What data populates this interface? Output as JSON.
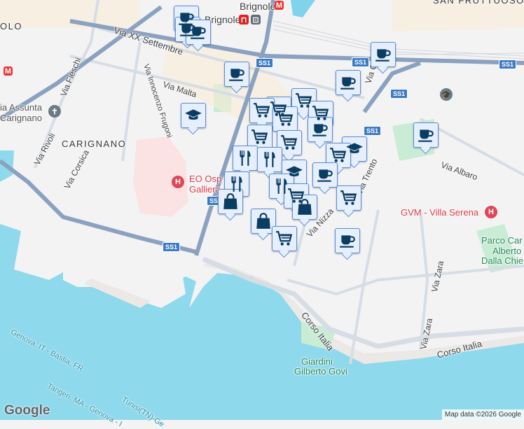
{
  "map": {
    "attribution": "Map data ©2026 Google",
    "logo": "Google",
    "colors": {
      "water": "#8fd9ec",
      "road_major": "#8aa2bf",
      "road": "#d6dde5",
      "park": "#c9ecd4",
      "hospital": "#fbe3e3",
      "marker_fill": "#e6effd",
      "marker_icon": "#0a3d62"
    },
    "labels": {
      "olo": "OLO",
      "san_fruttuoso": "SAN FRUTTUOSO",
      "brignole": "Brignole",
      "via_xx_settembre": "Via XX Settembre",
      "via_malta": "Via Malta",
      "via_frugoni": "Via Innocenzo Frugoni",
      "via_fieschi": "Via Fieschi",
      "assunta_1": "ia Assunta",
      "assunta_2": "Carignano",
      "carignano": "CARIGNANO",
      "via_rivoli": "Via Rivoli",
      "via_corsica": "Via Corsica",
      "galliera_1": "EO Osp",
      "galliera_2": "Galliera",
      "via_caffa": "Via Caff",
      "via_albaro": "Via Albaro",
      "via_trento": "Via Trento",
      "via_nizza": "Via Nizza",
      "villa_serena": "GVM - Villa Serena",
      "parco_1": "Parco Car",
      "parco_2": "Alberto",
      "parco_3": "Dalla Chie",
      "via_zara_1": "Via Zara",
      "via_zara_2": "Via Zara",
      "corso_italia_1": "Corso Italia",
      "corso_italia_2": "Corso Italia",
      "giardini_1": "Giardini",
      "giardini_2": "Gilberto Govi",
      "ferry_1": "Genova, IT - Bastia, FR",
      "ferry_2": "Tangeri, MA - Genova - I",
      "ferry_3": "Tunisi(TN)-Ge"
    },
    "shield": "SS1",
    "markers": [
      "coffee",
      "coffee",
      "coffee",
      "coffee",
      "graduation",
      "coffee",
      "coffee",
      "cart",
      "cart",
      "cart",
      "cart",
      "cart",
      "coffee",
      "cart",
      "graduation",
      "coffee",
      "cart",
      "cart",
      "restaurant",
      "restaurant",
      "graduation",
      "coffee",
      "restaurant",
      "restaurant",
      "cart",
      "cart",
      "bag",
      "bag",
      "bag",
      "cart",
      "coffee"
    ]
  }
}
